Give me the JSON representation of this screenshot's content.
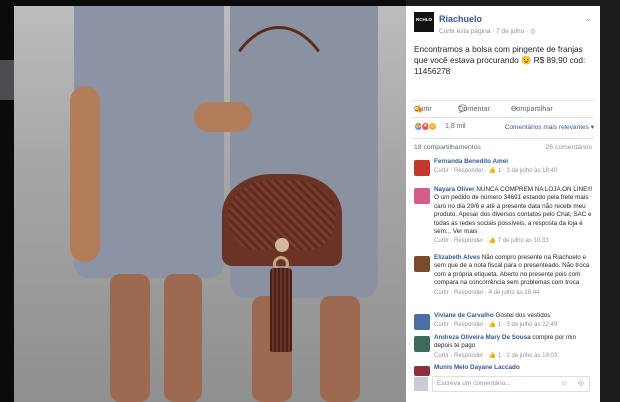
{
  "post": {
    "page_name": "Riachuelo",
    "logo_text": "RCHLO",
    "subtitle": "Curtir esta página · 7 de julho · ◎",
    "text": "Encontramos a bolsa com pingente de franjas que você estava procurando 😉 R$ 89,90 cod: 11456278"
  },
  "actions": {
    "like": "Curtir",
    "comment": "Comentar",
    "share": "Compartilhar"
  },
  "reactions": {
    "count": "1,8 mil",
    "sort_label": "Comentários mais relevantes ▾",
    "colors": {
      "like": "#5890ff",
      "love": "#f25268",
      "haha": "#f7b125"
    }
  },
  "stats": {
    "shares": "18 compartilhamentos",
    "comments": "26 comentários"
  },
  "comments": [
    {
      "author": "Fernanda Benedito Amei",
      "text": "",
      "meta": "Curtir · Responder · 👍 1 · 3 de julho às 18:40",
      "avatar_color": "#c0392b"
    },
    {
      "author": "Nayara Oliver",
      "text": "NUNCA COMPREM NA LOJA ON LINE!!! O um pedido de número 34691 estando pela frete mais caro no dia 29/6 e até a presente data não recebi meu produto. Apesar dos diversos contatos pelo Chat, SAC e todas as redes sociais possíveis, a resposta da loja é sem... Ver mais",
      "meta": "Curtir · Responder · 👍 7 de julho às 10:33",
      "avatar_color": "#d35d8b"
    },
    {
      "author": "Elizabeth Alves",
      "text": "Não compro presente na Riachuelo e sem que de a nota fiscal para o presenteado. Não troca com a própria etiqueta. Aberto no presente pois com compara na concorrência sem problemas com troca",
      "meta": "Curtir · Responder · 4 de julho às 18:44",
      "avatar_color": "#7a4b2a"
    },
    {
      "author": "Viviane de Carvalho",
      "text": "Gostei dos vestidos",
      "meta": "Curtir · Responder · 👍 1 · 3 de julho às 22:49",
      "avatar_color": "#4a6fa5"
    },
    {
      "author": "Andreza Oliveira Mary De Sousa",
      "text": "compre por min depois te pago",
      "meta": "Curtir · Responder · 👍 1 · 2 de julho às 19:03",
      "avatar_color": "#3d6b5a"
    },
    {
      "author": "Munis Melo Dayane Laccado",
      "text": "",
      "meta": "",
      "avatar_color": "#8e2f3c"
    }
  ],
  "comment_box": {
    "placeholder": "Escreva um comentário...",
    "icons": "☺ ◎"
  },
  "icons": {
    "chevron": "chevron-down-icon",
    "like": "thumbs-up-icon",
    "comment": "comment-icon",
    "share": "share-icon",
    "emoji": "emoji-icon",
    "camera": "camera-icon"
  },
  "colors": {
    "link": "#365899",
    "muted": "#90949c",
    "text": "#1d2129",
    "bag": "#6b3226",
    "dress": "#8b93a4"
  }
}
